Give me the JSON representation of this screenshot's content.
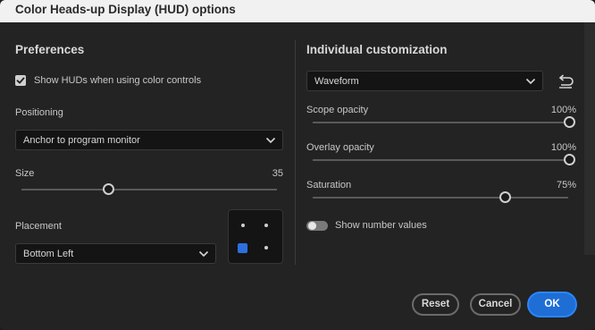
{
  "window": {
    "title": "Color Heads-up Display (HUD) options"
  },
  "preferences": {
    "heading": "Preferences",
    "show_huds_label": "Show HUDs when using color controls",
    "show_huds_checked": true,
    "positioning_label": "Positioning",
    "positioning_value": "Anchor to program monitor",
    "size_label": "Size",
    "size_value": "35",
    "placement_label": "Placement",
    "placement_value": "Bottom Left",
    "placement_selected_cell": "bottom-left"
  },
  "individual": {
    "heading": "Individual customization",
    "scope_select_value": "Waveform",
    "scope_opacity_label": "Scope opacity",
    "scope_opacity_value": "100%",
    "overlay_opacity_label": "Overlay opacity",
    "overlay_opacity_value": "100%",
    "saturation_label": "Saturation",
    "saturation_value": "75%",
    "show_number_values_label": "Show number values",
    "show_number_values_on": true
  },
  "footer": {
    "reset_label": "Reset",
    "cancel_label": "Cancel",
    "ok_label": "OK"
  },
  "colors": {
    "accent": "#1f6ed6",
    "background": "#232323",
    "titlebar": "#f1f1f1"
  }
}
